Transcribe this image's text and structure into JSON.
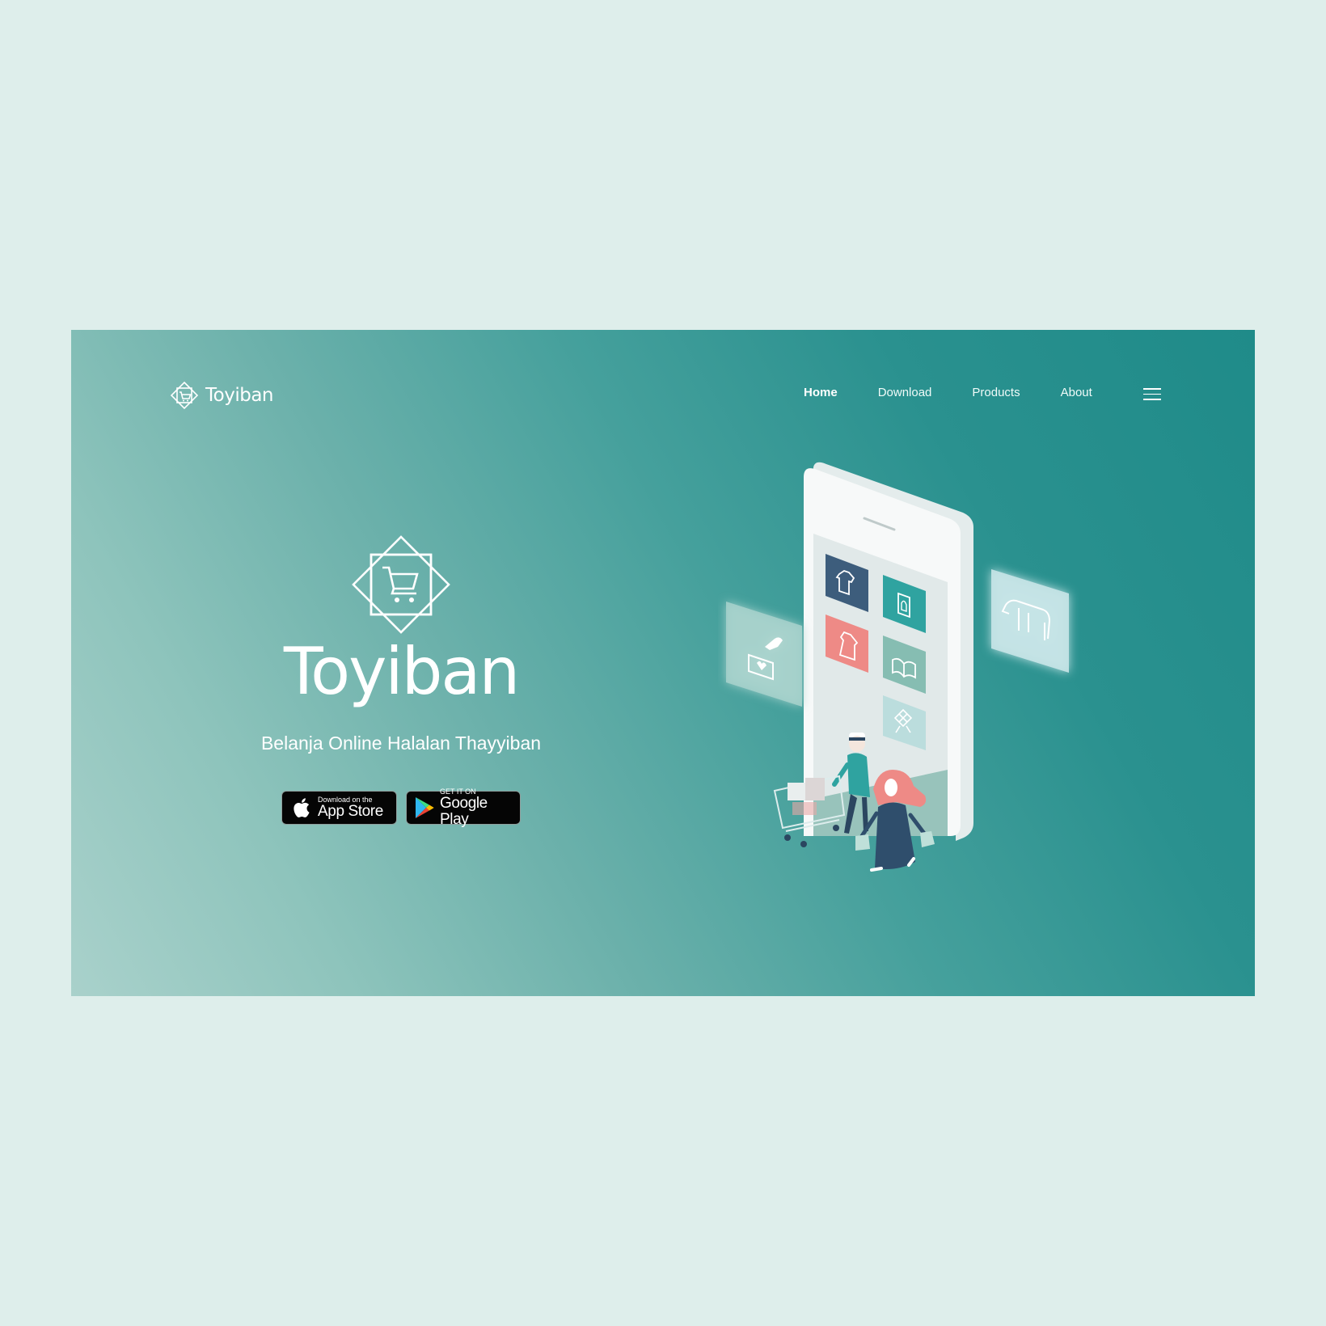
{
  "brand": {
    "name": "Toyiban"
  },
  "nav": {
    "items": [
      {
        "label": "Home",
        "active": true
      },
      {
        "label": "Download",
        "active": false
      },
      {
        "label": "Products",
        "active": false
      },
      {
        "label": "About",
        "active": false
      }
    ],
    "menu_icon": "hamburger-menu-icon"
  },
  "hero": {
    "title": "Toyiban",
    "tagline": "Belanja Online Halalan Thayyiban",
    "app_store": {
      "small": "Download on the",
      "large": "App Store",
      "icon": "apple-icon"
    },
    "google_play": {
      "small": "GET IT ON",
      "large": "Google Play",
      "icon": "play-triangle-icon"
    }
  },
  "colors": {
    "page_background": "#deeeeb",
    "hero_gradient_start": "#a9d1cb",
    "hero_gradient_end": "#1f8b89",
    "tile_navy": "#3d5d7c",
    "tile_teal": "#2fa3a0",
    "tile_coral": "#ee8a86",
    "tile_sage": "#86bdb2"
  }
}
